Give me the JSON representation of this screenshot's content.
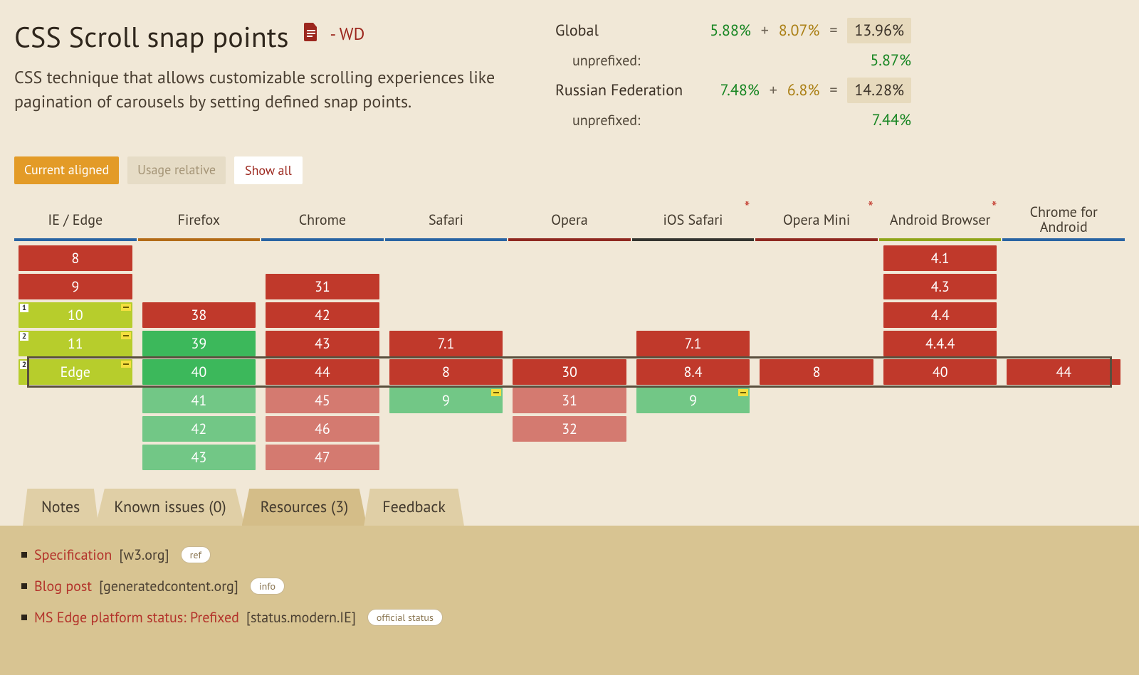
{
  "title": "CSS Scroll snap points",
  "spec_badge": "- WD",
  "description": "CSS technique that allows customizable scrolling experiences like pagination of carousels by setting defined snap points.",
  "stats": {
    "global": {
      "label": "Global",
      "supported": "5.88%",
      "prefixed": "8.07%",
      "total": "13.96%",
      "unprefixed_label": "unprefixed:",
      "unprefixed": "5.87%"
    },
    "region": {
      "label": "Russian Federation",
      "supported": "7.48%",
      "prefixed": "6.8%",
      "total": "14.28%",
      "unprefixed_label": "unprefixed:",
      "unprefixed": "7.44%"
    }
  },
  "filters": {
    "aligned": "Current aligned",
    "usage": "Usage relative",
    "showall": "Show all"
  },
  "browsers": [
    {
      "name": "IE / Edge",
      "sep": "#2964a3",
      "asterisk": false
    },
    {
      "name": "Firefox",
      "sep": "#b36b17",
      "asterisk": false
    },
    {
      "name": "Chrome",
      "sep": "#2964a3",
      "asterisk": false
    },
    {
      "name": "Safari",
      "sep": "#2964a3",
      "asterisk": false
    },
    {
      "name": "Opera",
      "sep": "#8f2820",
      "asterisk": false
    },
    {
      "name": "iOS Safari",
      "sep": "#34342f",
      "asterisk": true
    },
    {
      "name": "Opera Mini",
      "sep": "#8f2820",
      "asterisk": true
    },
    {
      "name": "Android Browser",
      "sep": "#8fa518",
      "asterisk": true
    },
    {
      "name": "Chrome for Android",
      "sep": "#2964a3",
      "asterisk": false
    }
  ],
  "grid": [
    [
      {
        "v": "8",
        "c": "c-red"
      },
      {
        "v": "9",
        "c": "c-red"
      },
      {
        "v": "10",
        "c": "c-olive",
        "note": "1",
        "flag": true
      },
      {
        "v": "11",
        "c": "c-olive",
        "note": "2",
        "flag": true
      },
      {
        "v": "Edge",
        "c": "c-olive",
        "note": "2",
        "flag": true,
        "current": true
      }
    ],
    [
      {
        "v": "",
        "c": "empty"
      },
      {
        "v": "",
        "c": "empty"
      },
      {
        "v": "38",
        "c": "c-red"
      },
      {
        "v": "39",
        "c": "c-green"
      },
      {
        "v": "40",
        "c": "c-green",
        "current": true
      },
      {
        "v": "41",
        "c": "c-green-lt"
      },
      {
        "v": "42",
        "c": "c-green-lt"
      },
      {
        "v": "43",
        "c": "c-green-lt"
      }
    ],
    [
      {
        "v": "",
        "c": "empty"
      },
      {
        "v": "31",
        "c": "c-red"
      },
      {
        "v": "42",
        "c": "c-red"
      },
      {
        "v": "43",
        "c": "c-red"
      },
      {
        "v": "44",
        "c": "c-red",
        "current": true
      },
      {
        "v": "45",
        "c": "c-red-lt"
      },
      {
        "v": "46",
        "c": "c-red-lt"
      },
      {
        "v": "47",
        "c": "c-red-lt"
      }
    ],
    [
      {
        "v": "",
        "c": "empty"
      },
      {
        "v": "",
        "c": "empty"
      },
      {
        "v": "",
        "c": "empty"
      },
      {
        "v": "7.1",
        "c": "c-red"
      },
      {
        "v": "8",
        "c": "c-red",
        "current": true
      },
      {
        "v": "9",
        "c": "c-green-lt",
        "flag": true
      }
    ],
    [
      {
        "v": "",
        "c": "empty"
      },
      {
        "v": "",
        "c": "empty"
      },
      {
        "v": "",
        "c": "empty"
      },
      {
        "v": "",
        "c": "empty"
      },
      {
        "v": "30",
        "c": "c-red",
        "current": true
      },
      {
        "v": "31",
        "c": "c-red-lt"
      },
      {
        "v": "32",
        "c": "c-red-lt"
      }
    ],
    [
      {
        "v": "",
        "c": "empty"
      },
      {
        "v": "",
        "c": "empty"
      },
      {
        "v": "",
        "c": "empty"
      },
      {
        "v": "7.1",
        "c": "c-red"
      },
      {
        "v": "8.4",
        "c": "c-red",
        "current": true
      },
      {
        "v": "9",
        "c": "c-green-lt",
        "flag": true
      }
    ],
    [
      {
        "v": "",
        "c": "empty"
      },
      {
        "v": "",
        "c": "empty"
      },
      {
        "v": "",
        "c": "empty"
      },
      {
        "v": "",
        "c": "empty"
      },
      {
        "v": "8",
        "c": "c-red",
        "current": true
      }
    ],
    [
      {
        "v": "4.1",
        "c": "c-red"
      },
      {
        "v": "4.3",
        "c": "c-red"
      },
      {
        "v": "4.4",
        "c": "c-red"
      },
      {
        "v": "4.4.4",
        "c": "c-red"
      },
      {
        "v": "40",
        "c": "c-red",
        "current": true
      }
    ],
    [
      {
        "v": "",
        "c": "empty"
      },
      {
        "v": "",
        "c": "empty"
      },
      {
        "v": "",
        "c": "empty"
      },
      {
        "v": "",
        "c": "empty"
      },
      {
        "v": "44",
        "c": "c-red",
        "current": true
      }
    ]
  ],
  "tabs": {
    "notes": "Notes",
    "issues": "Known issues (0)",
    "resources": "Resources (3)",
    "feedback": "Feedback"
  },
  "resources": [
    {
      "title": "Specification",
      "domain": "[w3.org]",
      "badge": "ref"
    },
    {
      "title": "Blog post",
      "domain": "[generatedcontent.org]",
      "badge": "info"
    },
    {
      "title": "MS Edge platform status: Prefixed",
      "domain": "[status.modern.IE]",
      "badge": "official status"
    }
  ]
}
